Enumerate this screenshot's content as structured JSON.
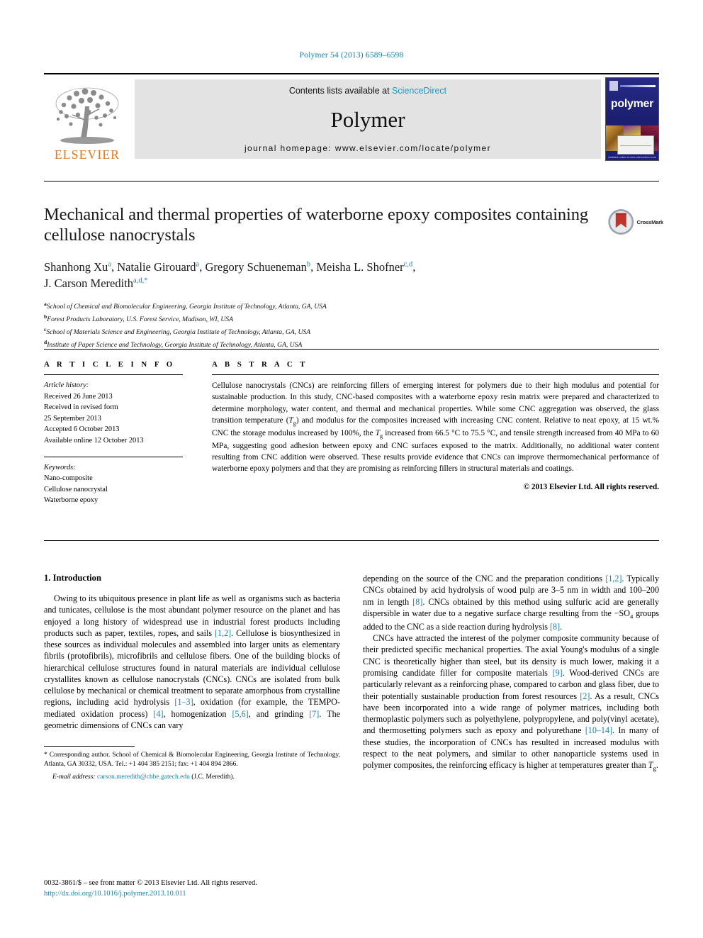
{
  "running_head": "Polymer 54 (2013) 6589–6598",
  "masthead": {
    "contents_prefix": "Contents lists available at ",
    "sciencedirect": "ScienceDirect",
    "journal_name": "Polymer",
    "homepage": "journal homepage: www.elsevier.com/locate/polymer",
    "publisher": "ELSEVIER",
    "cover_title": "polymer",
    "cover_footer": "Available online at www.sciencedirect.com"
  },
  "crossmark": {
    "label": "CrossMark"
  },
  "title": "Mechanical and thermal properties of waterborne epoxy composites containing cellulose nanocrystals",
  "authors_line1_a": "Shanhong Xu",
  "authors_line1_a_sup": "a",
  "authors_line1_b": ", Natalie Girouard",
  "authors_line1_b_sup": "a",
  "authors_line1_c": ", Gregory Schueneman",
  "authors_line1_c_sup": "b",
  "authors_line1_d": ", Meisha L. Shofner",
  "authors_line1_d_sup": "c,d",
  "authors_line1_end": ",",
  "authors_line2": "J. Carson Meredith",
  "authors_line2_sup": "a,d,*",
  "affiliations": [
    {
      "mark": "a",
      "text": "School of Chemical and Biomolecular Engineering, Georgia Institute of Technology, Atlanta, GA, USA"
    },
    {
      "mark": "b",
      "text": "Forest Products Laboratory, U.S. Forest Service, Madison, WI, USA"
    },
    {
      "mark": "c",
      "text": "School of Materials Science and Engineering, Georgia Institute of Technology, Atlanta, GA, USA"
    },
    {
      "mark": "d",
      "text": "Institute of Paper Science and Technology, Georgia Institute of Technology, Atlanta, GA, USA"
    }
  ],
  "article_info": {
    "heading": "A R T I C L E   I N F O",
    "history_label": "Article history:",
    "history": [
      "Received 26 June 2013",
      "Received in revised form",
      "25 September 2013",
      "Accepted 6 October 2013",
      "Available online 12 October 2013"
    ],
    "keywords_label": "Keywords:",
    "keywords": [
      "Nano-composite",
      "Cellulose nanocrystal",
      "Waterborne epoxy"
    ]
  },
  "abstract": {
    "heading": "A B S T R A C T",
    "part1": "Cellulose nanocrystals (CNCs) are reinforcing fillers of emerging interest for polymers due to their high modulus and potential for sustainable production. In this study, CNC-based composites with a waterborne epoxy resin matrix were prepared and characterized to determine morphology, water content, and thermal and mechanical properties. While some CNC aggregation was observed, the glass transition temperature (",
    "tg1": "T",
    "tg1_sub": "g",
    "part2": ") and modulus for the composites increased with increasing CNC content. Relative to neat epoxy, at 15 wt.% CNC the storage modulus increased by 100%, the ",
    "tg2": "T",
    "tg2_sub": "g",
    "part3": " increased from 66.5 °C to 75.5 °C, and tensile strength increased from 40 MPa to 60 MPa, suggesting good adhesion between epoxy and CNC surfaces exposed to the matrix. Additionally, no additional water content resulting from CNC addition were observed. These results provide evidence that CNCs can improve thermomechanical performance of waterborne epoxy polymers and that they are promising as reinforcing fillers in structural materials and coatings.",
    "copyright": "© 2013 Elsevier Ltd. All rights reserved."
  },
  "section1": {
    "heading": "1.  Introduction"
  },
  "left_column": {
    "p1_a": "Owing to its ubiquitous presence in plant life as well as organisms such as bacteria and tunicates, cellulose is the most abundant polymer resource on the planet and has enjoyed a long history of widespread use in industrial forest products including products such as paper, textiles, ropes, and sails ",
    "p1_ref1": "[1,2]",
    "p1_b": ". Cellulose is biosynthesized in these sources as individual molecules and assembled into larger units as elementary fibrils (protofibrils), microfibrils and cellulose fibers. One of the building blocks of hierarchical cellulose structures found in natural materials are individual cellulose crystallites known as cellulose nanocrystals (CNCs). CNCs are isolated from bulk cellulose by mechanical or chemical treatment to separate amorphous from crystalline regions, including acid hydrolysis ",
    "p1_ref2": "[1–3]",
    "p1_c": ", oxidation (for example, the TEMPO-mediated oxidation process) ",
    "p1_ref3": "[4]",
    "p1_d": ", homogenization ",
    "p1_ref4": "[5,6]",
    "p1_e": ", and grinding ",
    "p1_ref5": "[7]",
    "p1_f": ". The geometric dimensions of CNCs can vary"
  },
  "right_column": {
    "p1_a": "depending on the source of the CNC and the preparation conditions ",
    "p1_ref1": "[1,2]",
    "p1_b": ". Typically CNCs obtained by acid hydrolysis of wood pulp are 3–5 nm in width and 100–200 nm in length ",
    "p1_ref2": "[8]",
    "p1_c": ". CNCs obtained by this method using sulfuric acid are generally dispersible in water due to a negative surface charge resulting from the −SO",
    "p1_sub": "4",
    "p1_d": " groups added to the CNC as a side reaction during hydrolysis ",
    "p1_ref3": "[8]",
    "p1_e": ".",
    "p2_a": "CNCs have attracted the interest of the polymer composite community because of their predicted specific mechanical properties. The axial Young's modulus of a single CNC is theoretically higher than steel, but its density is much lower, making it a promising candidate filler for composite materials ",
    "p2_ref1": "[9]",
    "p2_b": ". Wood-derived CNCs are particularly relevant as a reinforcing phase, compared to carbon and glass fiber, due to their potentially sustainable production from forest resources ",
    "p2_ref2": "[2]",
    "p2_c": ". As a result, CNCs have been incorporated into a wide range of polymer matrices, including both thermoplastic polymers such as polyethylene, polypropylene, and poly(vinyl acetate), and thermosetting polymers such as epoxy and polyurethane ",
    "p2_ref3": "[10–14]",
    "p2_d": ". In many of these studies, the incorporation of CNCs has resulted in increased modulus with respect to the neat polymers, and similar to other nanoparticle systems used in polymer composites, the reinforcing efficacy is higher at temperatures greater than ",
    "p2_tg": "T",
    "p2_tg_sub": "g",
    "p2_e": "."
  },
  "footnote": {
    "star": "*",
    "text_a": " Corresponding author. School of Chemical & Biomolecular Engineering, Georgia Institute of Technology, Atlanta, GA 30332, USA. Tel.: +1 404 385 2151; fax: +1 404 894 2866.",
    "email_label": "E-mail address:",
    "email": "carson.meredith@chbe.gatech.edu",
    "email_suffix": " (J.C. Meredith)."
  },
  "imprint": {
    "line1": "0032-3861/$ – see front matter © 2013 Elsevier Ltd. All rights reserved.",
    "doi": "http://dx.doi.org/10.1016/j.polymer.2013.10.011"
  },
  "colors": {
    "link": "#1a7fa8",
    "elsevier_orange": "#e8761a",
    "cover_blue": "#1d1f7a",
    "masthead_gray": "#e3e3e3"
  }
}
